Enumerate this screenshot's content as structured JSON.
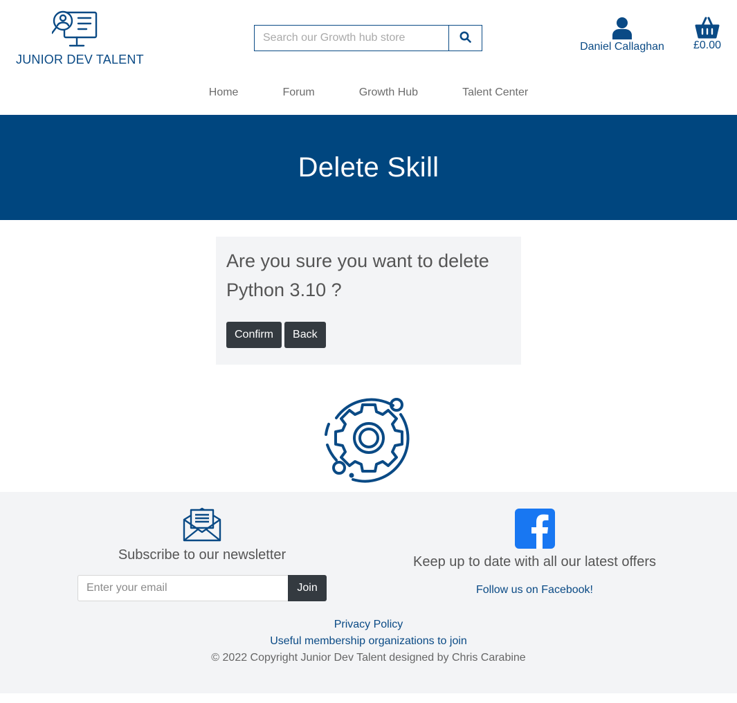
{
  "brand": {
    "name": "JUNIOR DEV TALENT",
    "icon": "talent-search-logo-icon"
  },
  "search": {
    "placeholder": "Search our Growth hub store",
    "icon": "search-icon"
  },
  "account": {
    "name": "Daniel Callaghan",
    "icon": "user-icon"
  },
  "basket": {
    "total": "£0.00",
    "icon": "basket-icon"
  },
  "nav": [
    {
      "label": "Home"
    },
    {
      "label": "Forum"
    },
    {
      "label": "Growth Hub"
    },
    {
      "label": "Talent Center"
    }
  ],
  "hero": {
    "title": "Delete Skill"
  },
  "confirm": {
    "question": "Are you sure you want to delete Python 3.10 ?",
    "confirm_label": "Confirm",
    "back_label": "Back"
  },
  "decoration": {
    "icon": "gear-orbit-icon"
  },
  "footer": {
    "newsletter": {
      "icon": "envelope-icon",
      "title": "Subscribe to our newsletter",
      "placeholder": "Enter your email",
      "join_label": "Join"
    },
    "social": {
      "icon": "facebook-icon",
      "title": "Keep up to date with all our latest offers",
      "link": "Follow us on Facebook!"
    },
    "privacy": "Privacy Policy",
    "memberships": "Useful membership organizations to join",
    "copyright": "© 2022 Copyright Junior Dev Talent designed by Chris Carabine"
  },
  "colors": {
    "brand_blue": "#0a4a85",
    "hero_blue": "#00467f",
    "dark_button": "#343a40",
    "light_panel": "#f3f4f6",
    "facebook_blue": "#1877f2"
  }
}
